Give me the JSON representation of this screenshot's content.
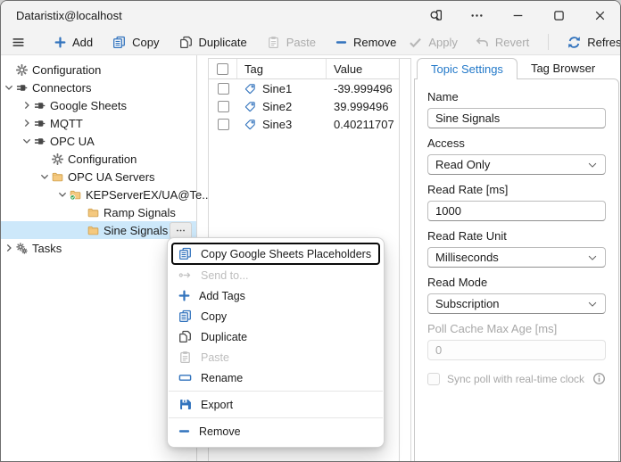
{
  "titlebar": {
    "title": "Dataristix@localhost",
    "icons": [
      "find-in-window-icon",
      "more-icon",
      "minimize-icon",
      "maximize-icon",
      "close-icon"
    ]
  },
  "toolbar": {
    "add": "Add",
    "copy": "Copy",
    "duplicate": "Duplicate",
    "paste": "Paste",
    "remove": "Remove",
    "apply": "Apply",
    "revert": "Revert",
    "refresh": "Refresh",
    "disabled_items": [
      "Paste",
      "Apply",
      "Revert"
    ]
  },
  "tree": {
    "items": [
      {
        "label": "Configuration",
        "level": 0,
        "chevron": "none",
        "icon": "gear-icon"
      },
      {
        "label": "Connectors",
        "level": 0,
        "chevron": "expanded",
        "icon": "connector-plug-icon"
      },
      {
        "label": "Google Sheets",
        "level": 1,
        "chevron": "collapsed",
        "icon": "connector-plug-icon"
      },
      {
        "label": "MQTT",
        "level": 1,
        "chevron": "collapsed",
        "icon": "connector-plug-icon"
      },
      {
        "label": "OPC UA",
        "level": 1,
        "chevron": "expanded",
        "icon": "connector-plug-icon"
      },
      {
        "label": "Configuration",
        "level": 2,
        "chevron": "none",
        "icon": "gear-icon"
      },
      {
        "label": "OPC UA Servers",
        "level": 2,
        "chevron": "expanded",
        "icon": "folder-icon"
      },
      {
        "label": "KEPServerEX/UA@Te...",
        "level": 3,
        "chevron": "expanded",
        "icon": "folder-check-icon"
      },
      {
        "label": "Ramp Signals",
        "level": 4,
        "chevron": "none",
        "icon": "folder-icon"
      },
      {
        "label": "Sine Signals",
        "level": 4,
        "chevron": "none",
        "icon": "folder-icon",
        "selected": true,
        "more_button": true
      },
      {
        "label": "Tasks",
        "level": 0,
        "chevron": "collapsed",
        "icon": "gears-icon"
      }
    ],
    "selection_bg": "#cde8fa"
  },
  "tag_table": {
    "columns": [
      "Tag",
      "Value"
    ],
    "rows": [
      {
        "tag": "Sine1",
        "value": "-39.999496",
        "checked": false
      },
      {
        "tag": "Sine2",
        "value": "39.999496",
        "checked": false
      },
      {
        "tag": "Sine3",
        "value": "0.40211707",
        "checked": false
      }
    ]
  },
  "settings_panel": {
    "tabs": [
      {
        "label": "Topic Settings",
        "active": true
      },
      {
        "label": "Tag Browser",
        "active": false
      }
    ],
    "fields": {
      "name": {
        "label": "Name",
        "value": "Sine Signals",
        "disabled": false
      },
      "access": {
        "label": "Access",
        "value": "Read Only",
        "disabled": false
      },
      "read_rate": {
        "label": "Read Rate [ms]",
        "value": "1000",
        "disabled": false
      },
      "read_rate_unit": {
        "label": "Read Rate Unit",
        "value": "Milliseconds",
        "disabled": false
      },
      "read_mode": {
        "label": "Read Mode",
        "value": "Subscription",
        "disabled": false
      },
      "poll_cache": {
        "label": "Poll Cache Max Age [ms]",
        "value": "0",
        "disabled": true
      },
      "sync_poll": {
        "label": "Sync poll with real-time clock",
        "checked": false,
        "disabled": true,
        "icon": "info-icon"
      }
    }
  },
  "context_menu": {
    "items": [
      {
        "label": "Copy Google Sheets Placeholders",
        "icon": "copy-icon",
        "enabled": true,
        "focused": true
      },
      {
        "label": "Send to...",
        "icon": "send-to-icon",
        "enabled": false
      },
      {
        "label": "Add Tags",
        "icon": "plus-icon",
        "enabled": true
      },
      {
        "label": "Copy",
        "icon": "copy-icon",
        "enabled": true
      },
      {
        "label": "Duplicate",
        "icon": "duplicate-icon",
        "enabled": true
      },
      {
        "label": "Paste",
        "icon": "paste-icon",
        "enabled": false
      },
      {
        "label": "Rename",
        "icon": "rename-icon",
        "enabled": true
      },
      {
        "label": "Export",
        "icon": "export-floppy-icon",
        "enabled": true
      },
      {
        "label": "Remove",
        "icon": "minus-icon",
        "enabled": true
      }
    ]
  },
  "colors": {
    "accent_blue": "#3273bd",
    "active_tab_text": "#2379c9",
    "selection_bg": "#cde8fa",
    "folder_fill": "#f5c97f",
    "folder_stroke": "#cf9f4d",
    "check_badge_green": "#31a24c",
    "titlebar_bg": "#f3f3f3",
    "disabled_text": "#ababab"
  }
}
